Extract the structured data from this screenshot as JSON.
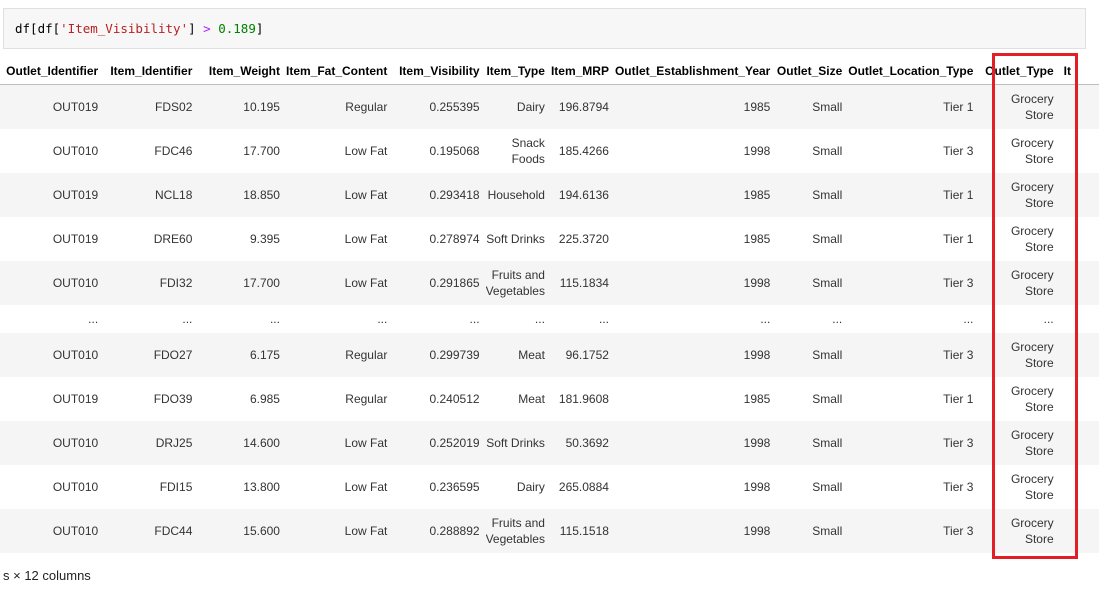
{
  "code": {
    "segments": [
      {
        "text": "df[df[",
        "kind": "name"
      },
      {
        "text": "'Item_Visibility'",
        "kind": "str"
      },
      {
        "text": "] ",
        "kind": "name"
      },
      {
        "text": ">",
        "kind": "op"
      },
      {
        "text": " ",
        "kind": "name"
      },
      {
        "text": "0.189",
        "kind": "num"
      },
      {
        "text": "]",
        "kind": "name"
      }
    ]
  },
  "table": {
    "headers": [
      "Outlet_Identifier",
      "Item_Identifier",
      "Item_Weight",
      "Item_Fat_Content",
      "Item_Visibility",
      "Item_Type",
      "Item_MRP",
      "Outlet_Establishment_Year",
      "Outlet_Size",
      "Outlet_Location_Type",
      "Outlet_Type",
      "It"
    ],
    "rows": [
      [
        "OUT019",
        "FDS02",
        "10.195",
        "Regular",
        "0.255395",
        "Dairy",
        "196.8794",
        "1985",
        "Small",
        "Tier 1",
        "Grocery Store",
        ""
      ],
      [
        "OUT010",
        "FDC46",
        "17.700",
        "Low Fat",
        "0.195068",
        "Snack Foods",
        "185.4266",
        "1998",
        "Small",
        "Tier 3",
        "Grocery Store",
        ""
      ],
      [
        "OUT019",
        "NCL18",
        "18.850",
        "Low Fat",
        "0.293418",
        "Household",
        "194.6136",
        "1985",
        "Small",
        "Tier 1",
        "Grocery Store",
        ""
      ],
      [
        "OUT019",
        "DRE60",
        "9.395",
        "Low Fat",
        "0.278974",
        "Soft Drinks",
        "225.3720",
        "1985",
        "Small",
        "Tier 1",
        "Grocery Store",
        ""
      ],
      [
        "OUT010",
        "FDI32",
        "17.700",
        "Low Fat",
        "0.291865",
        "Fruits and Vegetables",
        "115.1834",
        "1998",
        "Small",
        "Tier 3",
        "Grocery Store",
        ""
      ],
      [
        "...",
        "...",
        "...",
        "...",
        "...",
        "...",
        "...",
        "...",
        "...",
        "...",
        "...",
        ""
      ],
      [
        "OUT010",
        "FDO27",
        "6.175",
        "Regular",
        "0.299739",
        "Meat",
        "96.1752",
        "1998",
        "Small",
        "Tier 3",
        "Grocery Store",
        ""
      ],
      [
        "OUT019",
        "FDO39",
        "6.985",
        "Regular",
        "0.240512",
        "Meat",
        "181.9608",
        "1985",
        "Small",
        "Tier 1",
        "Grocery Store",
        ""
      ],
      [
        "OUT010",
        "DRJ25",
        "14.600",
        "Low Fat",
        "0.252019",
        "Soft Drinks",
        "50.3692",
        "1998",
        "Small",
        "Tier 3",
        "Grocery Store",
        ""
      ],
      [
        "OUT010",
        "FDI15",
        "13.800",
        "Low Fat",
        "0.236595",
        "Dairy",
        "265.0884",
        "1998",
        "Small",
        "Tier 3",
        "Grocery Store",
        ""
      ],
      [
        "OUT010",
        "FDC44",
        "15.600",
        "Low Fat",
        "0.288892",
        "Fruits and Vegetables",
        "115.1518",
        "1998",
        "Small",
        "Tier 3",
        "Grocery Store",
        ""
      ]
    ]
  },
  "footer": {
    "shape_text": "s × 12 columns"
  },
  "colors": {
    "highlight": "#e21f26"
  }
}
